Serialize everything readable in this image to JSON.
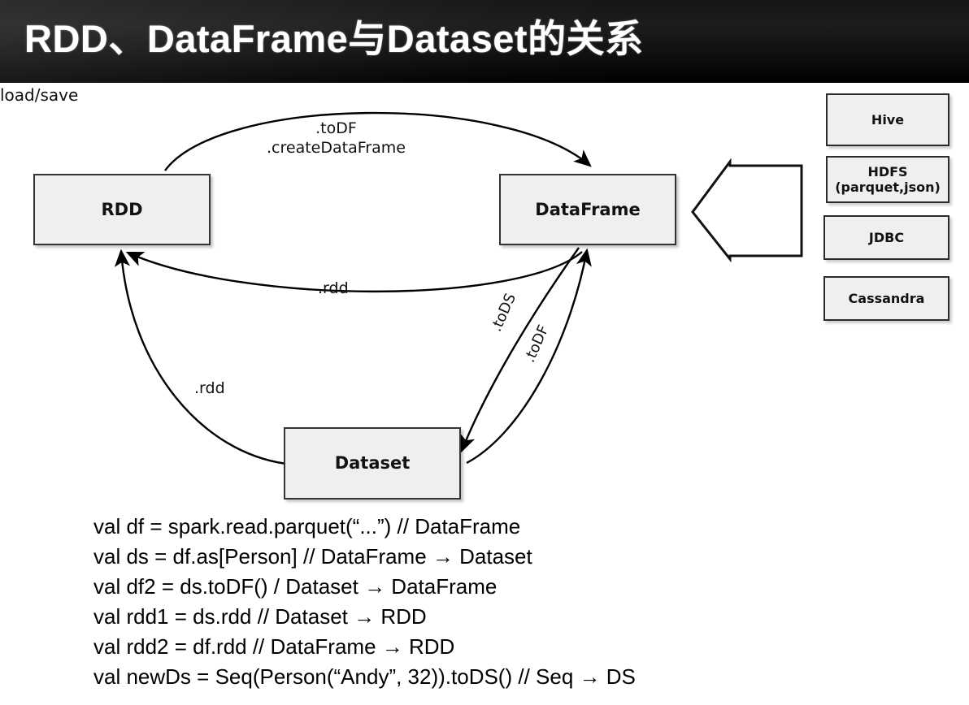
{
  "header": {
    "title": "RDD、DataFrame与Dataset的关系"
  },
  "diagram": {
    "nodes": {
      "rdd": "RDD",
      "dataframe": "DataFrame",
      "dataset": "Dataset"
    },
    "sources": [
      {
        "key": "hive",
        "label": "Hive"
      },
      {
        "key": "hdfs",
        "label": "HDFS\n(parquet,json)"
      },
      {
        "key": "jdbc",
        "label": "JDBC"
      },
      {
        "key": "cassandra",
        "label": "Cassandra"
      }
    ],
    "edges": {
      "rdd_to_dataframe": ".toDF\n.createDataFrame",
      "dataframe_to_rdd": ".rdd",
      "dataset_to_rdd": ".rdd",
      "dataframe_to_dataset": ".toDS",
      "dataset_to_dataframe": ".toDF",
      "load_save": "load/save"
    }
  },
  "code": {
    "lines": [
      "val df = spark.read.parquet(“...”) // DataFrame",
      "val ds = df.as[Person] // DataFrame →  Dataset",
      "val df2 = ds.toDF() / Dataset →  DataFrame",
      "val rdd1 = ds.rdd // Dataset →  RDD",
      "val rdd2 = df.rdd // DataFrame →  RDD",
      "val newDs = Seq(Person(“Andy”, 32)).toDS() // Seq →  DS"
    ]
  },
  "colors": {
    "header_background": "#111111",
    "header_text": "#ffffff",
    "node_fill": "#efefef",
    "node_border": "#333333",
    "page_background": "#ffffff",
    "edge_stroke": "#000000"
  }
}
